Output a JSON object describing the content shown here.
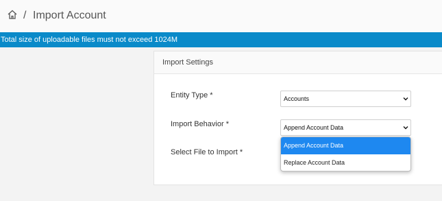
{
  "breadcrumb": {
    "home_icon": "home-icon",
    "separator": "/",
    "title": "Import Account"
  },
  "banner": {
    "text": "Total size of uploadable files must not exceed 1024M",
    "color": "#0a8ac9"
  },
  "panel": {
    "header": "Import Settings",
    "fields": {
      "entity_type": {
        "label": "Entity Type *",
        "value": "Accounts"
      },
      "import_behavior": {
        "label": "Import Behavior *",
        "value": "Append Account Data"
      },
      "select_file": {
        "label": "Select File to Import *"
      }
    }
  },
  "dropdown": {
    "options": [
      "Append Account Data",
      "Replace Account Data"
    ],
    "highlight_color": "#1e88f0"
  }
}
